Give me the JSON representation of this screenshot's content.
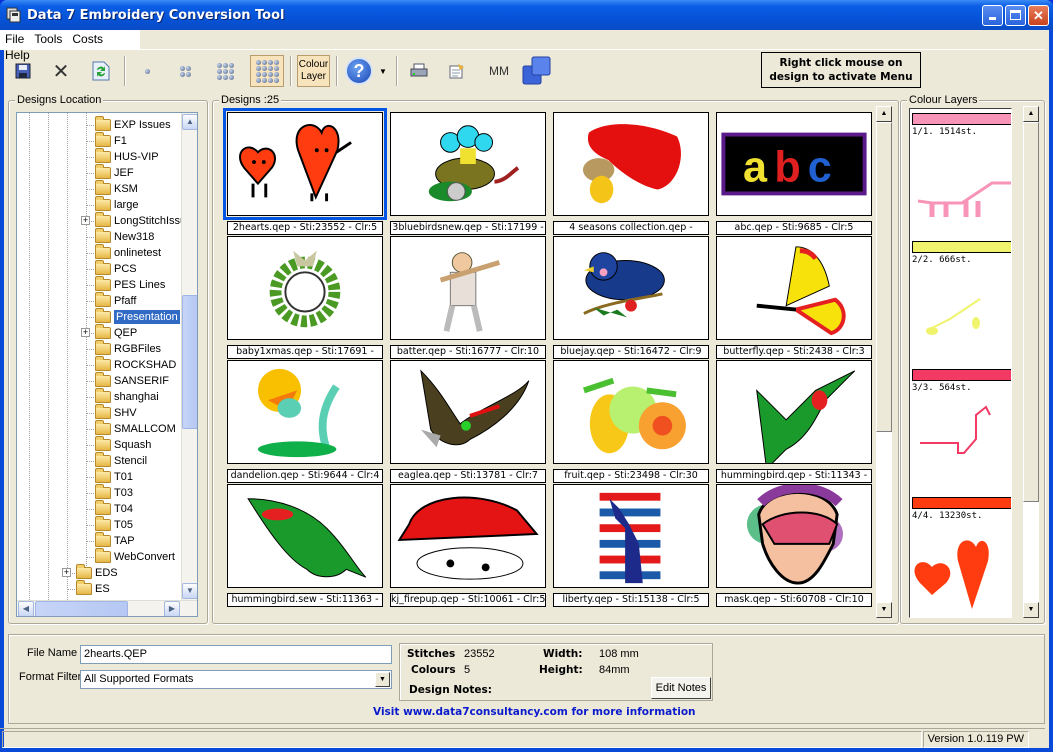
{
  "window": {
    "title": "Data 7 Embroidery Conversion Tool",
    "controls": {
      "minimize": "_",
      "maximize": "□",
      "close": "✕"
    }
  },
  "menu": [
    "File",
    "Tools",
    "Costs",
    "Help"
  ],
  "toolbar": {
    "save_icon": "floppy-disk-icon",
    "delete_icon": "x-icon",
    "refresh_icon": "refresh-icon",
    "view_1_icon": "single-dot-icon",
    "view_4_icon": "4-dot-grid-icon",
    "view_9_icon": "9-dot-grid-icon",
    "view_16_icon": "16-dot-grid-icon",
    "colour_layer_label_1": "Colour",
    "colour_layer_label_2": "Layer",
    "help_label": "?",
    "mm_label": "MM",
    "hint_line1": "Right click mouse on",
    "hint_line2": "design to activate Menu"
  },
  "designs_location": {
    "label": "Designs Location",
    "folders": [
      {
        "name": "EXP Issues",
        "level": 3,
        "expandable": false
      },
      {
        "name": "F1",
        "level": 3,
        "expandable": false
      },
      {
        "name": "HUS-VIP",
        "level": 3,
        "expandable": false
      },
      {
        "name": "JEF",
        "level": 3,
        "expandable": false
      },
      {
        "name": "KSM",
        "level": 3,
        "expandable": false
      },
      {
        "name": "large",
        "level": 3,
        "expandable": false
      },
      {
        "name": "LongStitchIssues",
        "level": 3,
        "expandable": true
      },
      {
        "name": "New318",
        "level": 3,
        "expandable": false
      },
      {
        "name": "onlinetest",
        "level": 3,
        "expandable": false
      },
      {
        "name": "PCS",
        "level": 3,
        "expandable": false
      },
      {
        "name": "PES Lines",
        "level": 3,
        "expandable": false
      },
      {
        "name": "Pfaff",
        "level": 3,
        "expandable": false
      },
      {
        "name": "Presentation",
        "level": 3,
        "expandable": false,
        "selected": true
      },
      {
        "name": "QEP",
        "level": 3,
        "expandable": true
      },
      {
        "name": "RGBFiles",
        "level": 3,
        "expandable": false
      },
      {
        "name": "ROCKSHAD",
        "level": 3,
        "expandable": false
      },
      {
        "name": "SANSERIF",
        "level": 3,
        "expandable": false
      },
      {
        "name": "shanghai",
        "level": 3,
        "expandable": false
      },
      {
        "name": "SHV",
        "level": 3,
        "expandable": false
      },
      {
        "name": "SMALLCOM",
        "level": 3,
        "expandable": false
      },
      {
        "name": "Squash",
        "level": 3,
        "expandable": false
      },
      {
        "name": "Stencil",
        "level": 3,
        "expandable": false
      },
      {
        "name": "T01",
        "level": 3,
        "expandable": false
      },
      {
        "name": "T03",
        "level": 3,
        "expandable": false
      },
      {
        "name": "T04",
        "level": 3,
        "expandable": false
      },
      {
        "name": "T05",
        "level": 3,
        "expandable": false
      },
      {
        "name": "TAP",
        "level": 3,
        "expandable": false
      },
      {
        "name": "WebConvert",
        "level": 3,
        "expandable": false
      },
      {
        "name": "EDS",
        "level": 2,
        "expandable": true
      },
      {
        "name": "ES",
        "level": 2,
        "expandable": false
      }
    ]
  },
  "designs": {
    "label": "Designs :25",
    "items": [
      {
        "caption": "2hearts.qep - Sti:23552 - Clr:5",
        "art": "hearts",
        "selected": true
      },
      {
        "caption": "3bluebirdsnew.qep - Sti:17199 -",
        "art": "bluebirds"
      },
      {
        "caption": "4 seasons collection.qep -",
        "art": "leaf"
      },
      {
        "caption": "abc.qep - Sti:9685 - Clr:5",
        "art": "abc"
      },
      {
        "caption": "baby1xmas.qep - Sti:17691 -",
        "art": "wreath"
      },
      {
        "caption": "batter.qep - Sti:16777 - Clr:10",
        "art": "batter"
      },
      {
        "caption": "bluejay.qep - Sti:16472 - Clr:9",
        "art": "bluejay"
      },
      {
        "caption": "butterfly.qep - Sti:2438 - Clr:3",
        "art": "butterfly"
      },
      {
        "caption": "dandelion.qep - Sti:9644 - Clr:4",
        "art": "dandelion"
      },
      {
        "caption": "eaglea.qep - Sti:13781 - Clr:7",
        "art": "eagle"
      },
      {
        "caption": "fruit.qep - Sti:23498 - Clr:30",
        "art": "fruit"
      },
      {
        "caption": "hummingbird.qep - Sti:11343 -",
        "art": "hummingbird"
      },
      {
        "caption": "hummingbird.sew - Sti:11363 -",
        "art": "hummingbird2"
      },
      {
        "caption": "kj_firepup.qep - Sti:10061 - Clr:5",
        "art": "firepup"
      },
      {
        "caption": "liberty.qep - Sti:15138 - Clr:5",
        "art": "liberty"
      },
      {
        "caption": "mask.qep - Sti:60708 - Clr:10",
        "art": "mask"
      }
    ]
  },
  "colour_layers": {
    "label": "Colour Layers",
    "layers": [
      {
        "label": "1/1. 1514st.",
        "color": "#f794b8"
      },
      {
        "label": "2/2. 666st.",
        "color": "#f0f46c"
      },
      {
        "label": "3/3. 564st.",
        "color": "#f23a64"
      },
      {
        "label": "4/4. 13230st.",
        "color": "#ff3c10"
      }
    ]
  },
  "details": {
    "file_name_label": "File Name",
    "file_name_value": "2hearts.QEP",
    "format_filter_label": "Format Filter",
    "format_filter_value": "All Supported Formats",
    "stitches_label": "Stitches",
    "stitches_value": "23552",
    "colours_label": "Colours",
    "colours_value": "5",
    "width_label": "Width:",
    "width_value": "108 mm",
    "height_label": "Height:",
    "height_value": "84mm",
    "notes_label": "Design Notes:",
    "edit_notes_label": "Edit Notes",
    "visit_text": "Visit www.data7consultancy.com for more information"
  },
  "status": {
    "version": "Version 1.0.119 PW"
  },
  "colors": {
    "accent": "#0055e5",
    "link": "#0000cc",
    "selection": "#316ac5"
  }
}
